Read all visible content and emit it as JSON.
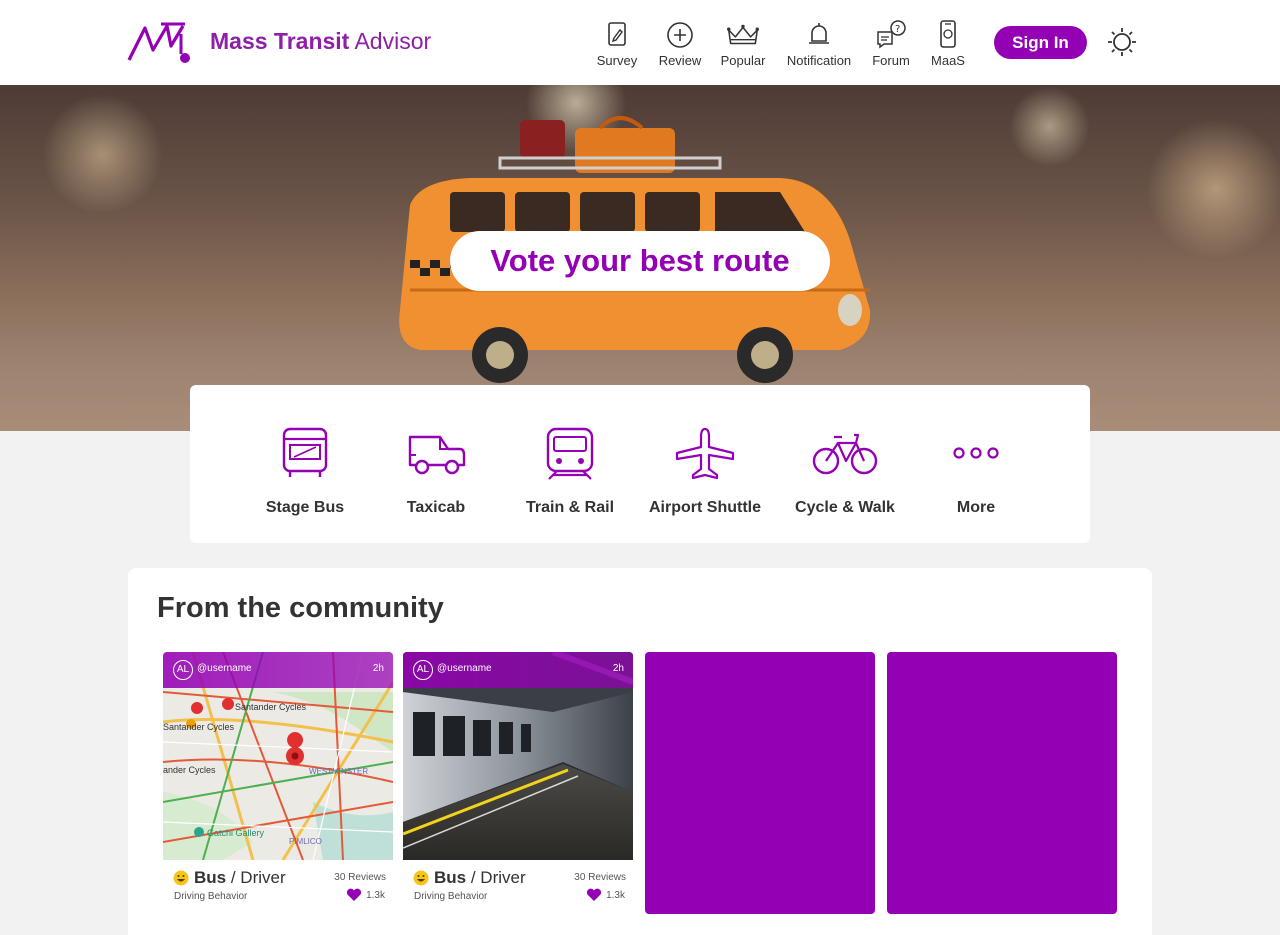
{
  "header": {
    "brand_bold": "Mass Transit",
    "brand_light": "Advisor",
    "nav": [
      {
        "label": "Survey",
        "icon": "survey-icon"
      },
      {
        "label": "Review",
        "icon": "plus-circle-icon"
      },
      {
        "label": "Popular",
        "icon": "crown-icon"
      },
      {
        "label": "Notification",
        "icon": "bell-icon"
      },
      {
        "label": "Forum",
        "icon": "forum-icon"
      },
      {
        "label": "MaaS",
        "icon": "phone-icon"
      }
    ],
    "signin_label": "Sign In",
    "theme_icon": "sun-icon"
  },
  "hero": {
    "cta": "Vote your best route"
  },
  "categories": [
    {
      "label": "Stage Bus",
      "icon": "bus-icon"
    },
    {
      "label": "Taxicab",
      "icon": "taxi-icon"
    },
    {
      "label": "Train & Rail",
      "icon": "train-icon"
    },
    {
      "label": "Airport Shuttle",
      "icon": "plane-icon"
    },
    {
      "label": "Cycle & Walk",
      "icon": "bicycle-icon"
    },
    {
      "label": "More",
      "icon": "more-icon"
    }
  ],
  "community": {
    "title": "From the community",
    "posts": [
      {
        "avatar": "AL",
        "username": "@username",
        "age": "2h",
        "mode": "Bus",
        "role": "/ Driver",
        "reviews": "30 Reviews",
        "topic": "Driving Behavior",
        "likes": "1.3k",
        "map_labels": [
          "Santander Cycles",
          "Santander Cycles",
          "ander Cycles",
          "WESTMINSTER",
          "Gatchi Gallery",
          "PIMLICO"
        ]
      },
      {
        "avatar": "AL",
        "username": "@username",
        "age": "2h",
        "mode": "Bus",
        "role": "/ Driver",
        "reviews": "30 Reviews",
        "topic": "Driving Behavior",
        "likes": "1.3k"
      }
    ]
  },
  "colors": {
    "brand": "#9400b4",
    "text": "#333333",
    "background": "#f2f2f2"
  }
}
